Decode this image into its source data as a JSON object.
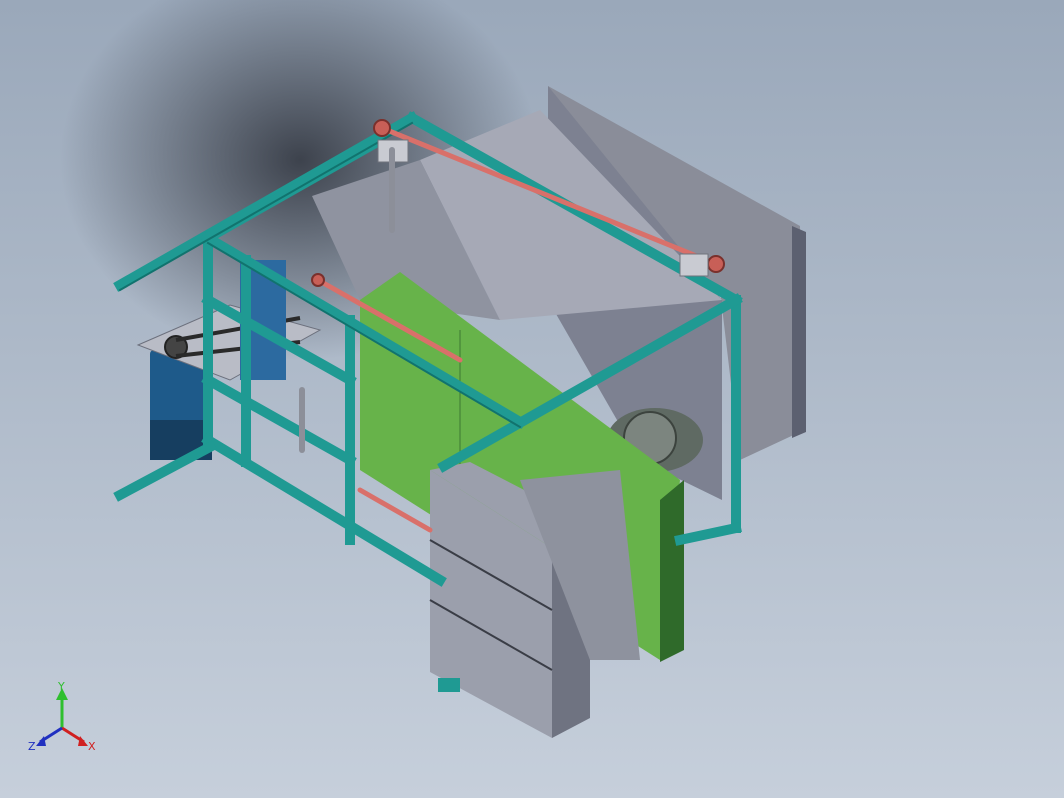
{
  "viewport": {
    "background_top": "#9aa8ba",
    "background_bottom": "#c6cfdb"
  },
  "model": {
    "colors": {
      "frame": "#1f9a93",
      "frame_dark": "#11736e",
      "hopper": "#7d8191",
      "hopper_light": "#a6a9b6",
      "sieve_plate": "#67b34a",
      "sieve_plate_dark": "#2f6a2a",
      "linkage_rod": "#d9706a",
      "motor": "#1e5a8a",
      "motor_dark": "#163e60",
      "block": "#9b9fac",
      "block_dark": "#6f7381"
    }
  },
  "triad": {
    "y_label": "Y",
    "x_label": "X",
    "z_label": "Z",
    "y_color": "#2fbf2f",
    "x_color": "#d02020",
    "z_color": "#2030c0"
  }
}
